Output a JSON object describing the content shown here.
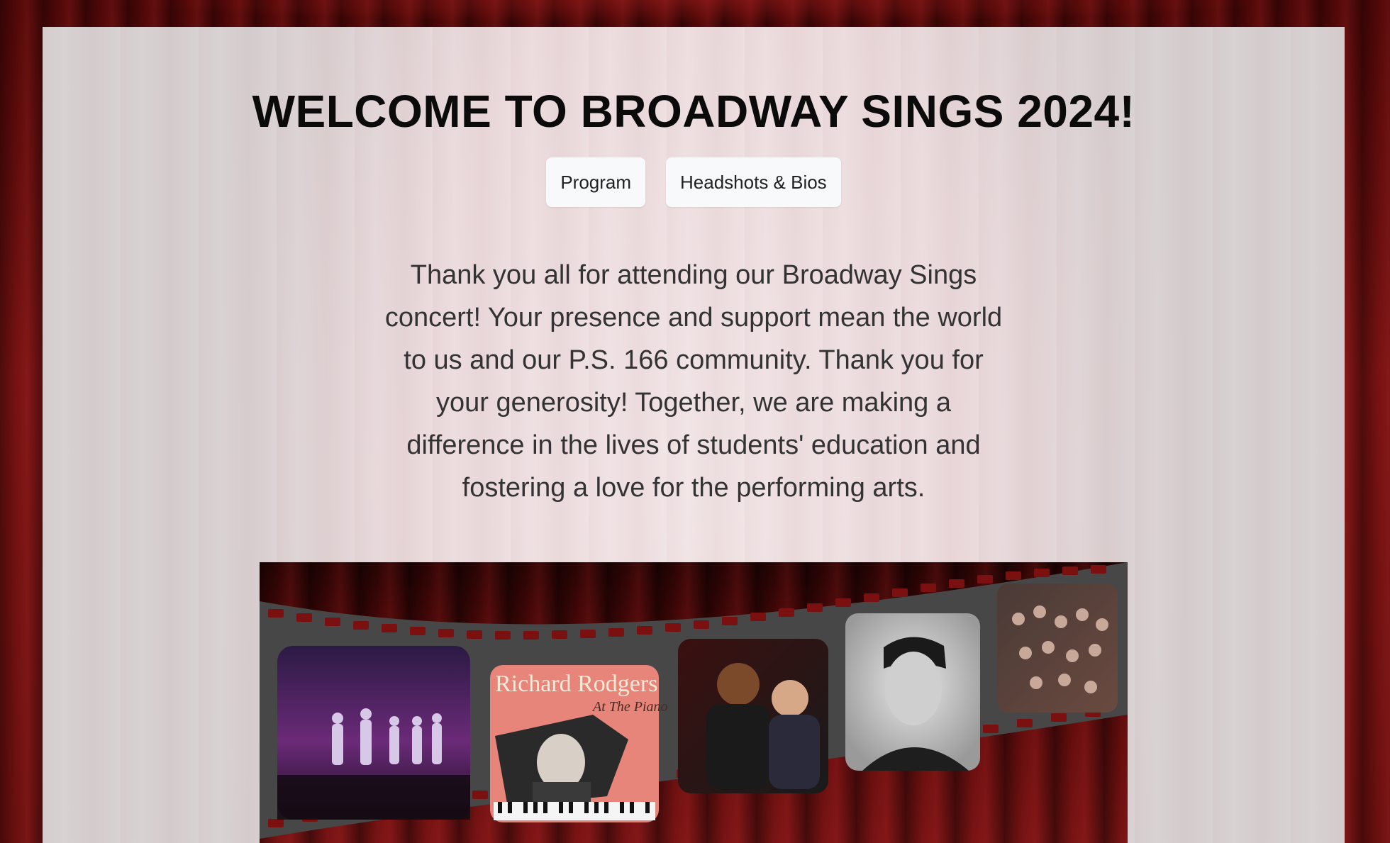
{
  "page": {
    "title": "WELCOME TO BROADWAY SINGS 2024!",
    "nav": [
      {
        "label": "Program"
      },
      {
        "label": "Headshots & Bios"
      }
    ],
    "intro": "Thank you all for attending our Broadway Sings concert! Your presence and support mean the world to us and our P.S. 166 community. Thank you for your generosity! Together, we are making a difference in the lives of students' education and fostering a love for the performing arts."
  },
  "banner": {
    "frames": [
      {
        "name": "concert-stage-photo"
      },
      {
        "name": "richard-rodgers-album-cover",
        "title": "Richard Rodgers",
        "subtitle": "At The Piano"
      },
      {
        "name": "singers-duet-photo"
      },
      {
        "name": "portrait-photo"
      },
      {
        "name": "student-audience-photo"
      }
    ]
  },
  "colors": {
    "curtain": "#6a0f0f",
    "panel": "#ecdcde",
    "film": "#4a4a4a",
    "button_bg": "#f8f9fb",
    "title_text": "#0b0b0b",
    "body_text": "#333333"
  }
}
